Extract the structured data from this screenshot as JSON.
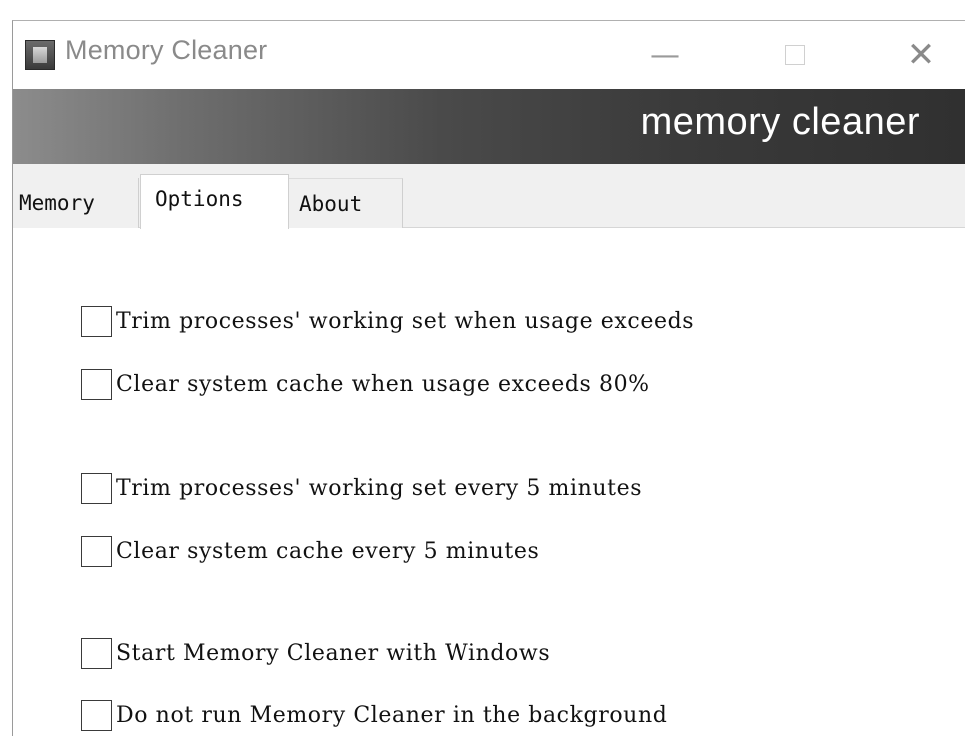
{
  "window": {
    "title": "Memory Cleaner",
    "controls": {
      "minimize": "—",
      "close": "✕"
    }
  },
  "banner": {
    "text": "memory cleaner"
  },
  "tabs": [
    {
      "label": "Memory",
      "selected": false
    },
    {
      "label": "Options",
      "selected": true
    },
    {
      "label": "About",
      "selected": false
    }
  ],
  "options": [
    {
      "label": "Trim processes' working set when usage exceeds",
      "checked": false
    },
    {
      "label": "Clear system cache when usage exceeds 80%",
      "checked": false
    },
    {
      "label": "Trim processes' working set every 5 minutes",
      "checked": false
    },
    {
      "label": "Clear system cache every 5 minutes",
      "checked": false
    },
    {
      "label": "Start Memory Cleaner with Windows",
      "checked": false
    },
    {
      "label": "Do not run Memory Cleaner in the background",
      "checked": false
    }
  ],
  "colors": {
    "banner_dark": "#303030",
    "banner_light": "#8c8c8c",
    "title_text": "#8a8a8a"
  }
}
